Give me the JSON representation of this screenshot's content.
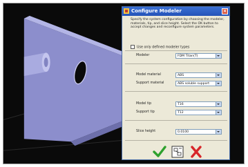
{
  "dialog": {
    "title": "Configure Modeler",
    "description": "Specify the system configuration by choosing the modeler, materials, tip, and slice height. Select the OK button to accept changes and reconfigure system parameters.",
    "use_only_defined_label": "Use only defined modeler types",
    "fields": {
      "modeler": {
        "label": "Modeler",
        "value": "FDM Titan(T)"
      },
      "model_material": {
        "label": "Model material",
        "value": "ABS"
      },
      "support_material": {
        "label": "Support material",
        "value": "ABS soluble support"
      },
      "model_tip": {
        "label": "Model tip",
        "value": "T16"
      },
      "support_tip": {
        "label": "Support tip",
        "value": "T12"
      },
      "slice_height": {
        "label": "Slice height",
        "value": "0.0100"
      }
    },
    "buttons": {
      "ok_icon": "green-checkmark-icon",
      "details_icon": "config-details-icon",
      "cancel_icon": "red-x-icon"
    }
  },
  "colors": {
    "viewport_bg": "#0a0a0a",
    "part": "#9a9cd6",
    "ok_green": "#2ea12e",
    "cancel_red": "#d7262a"
  }
}
